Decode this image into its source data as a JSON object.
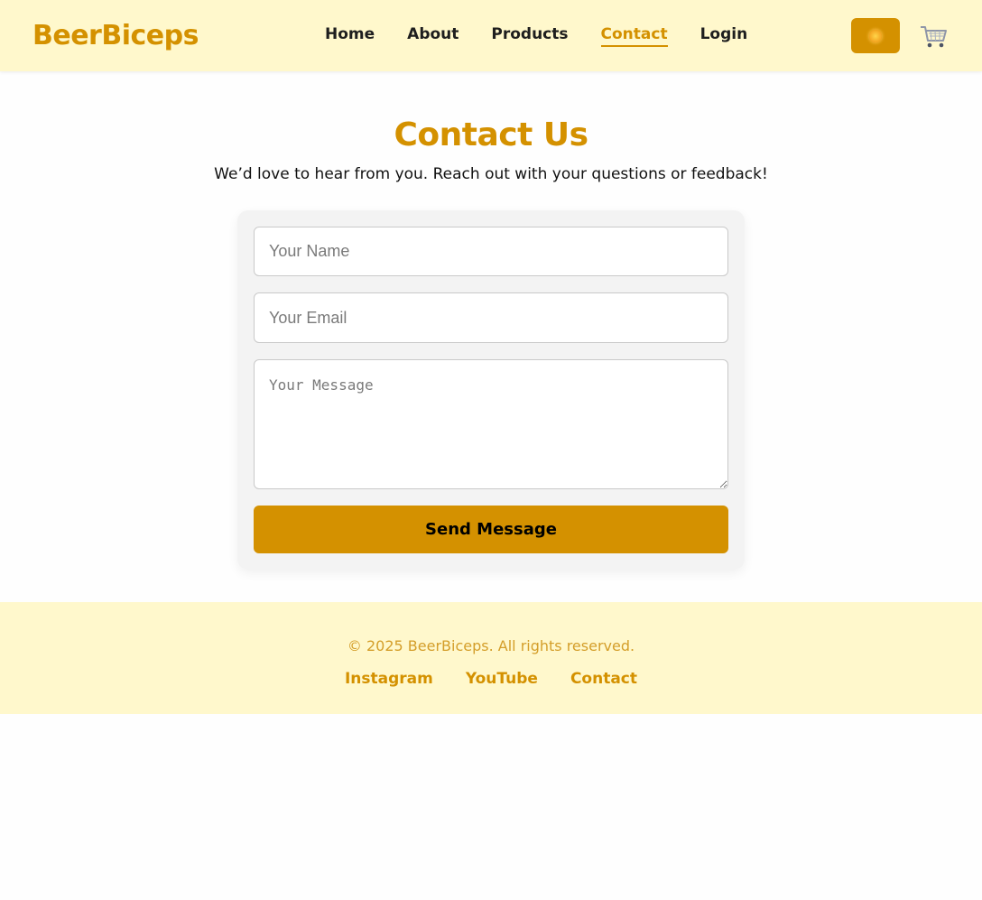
{
  "brand": "BeerBiceps",
  "nav": {
    "items": [
      {
        "label": "Home",
        "active": false
      },
      {
        "label": "About",
        "active": false
      },
      {
        "label": "Products",
        "active": false
      },
      {
        "label": "Contact",
        "active": true
      },
      {
        "label": "Login",
        "active": false
      }
    ],
    "theme_toggle_icon": "sun-icon",
    "cart_icon": "cart-icon"
  },
  "contact": {
    "title": "Contact Us",
    "subtitle": "We’d love to hear from you. Reach out with your questions or feedback!",
    "name_placeholder": "Your Name",
    "email_placeholder": "Your Email",
    "message_placeholder": "Your Message",
    "submit_label": "Send Message"
  },
  "footer": {
    "copyright": "© 2025 BeerBiceps. All rights reserved.",
    "links": [
      "Instagram",
      "YouTube",
      "Contact"
    ]
  },
  "colors": {
    "accent": "#d49100",
    "header_bg": "#fff8cc",
    "card_bg": "#f3f3f3"
  }
}
